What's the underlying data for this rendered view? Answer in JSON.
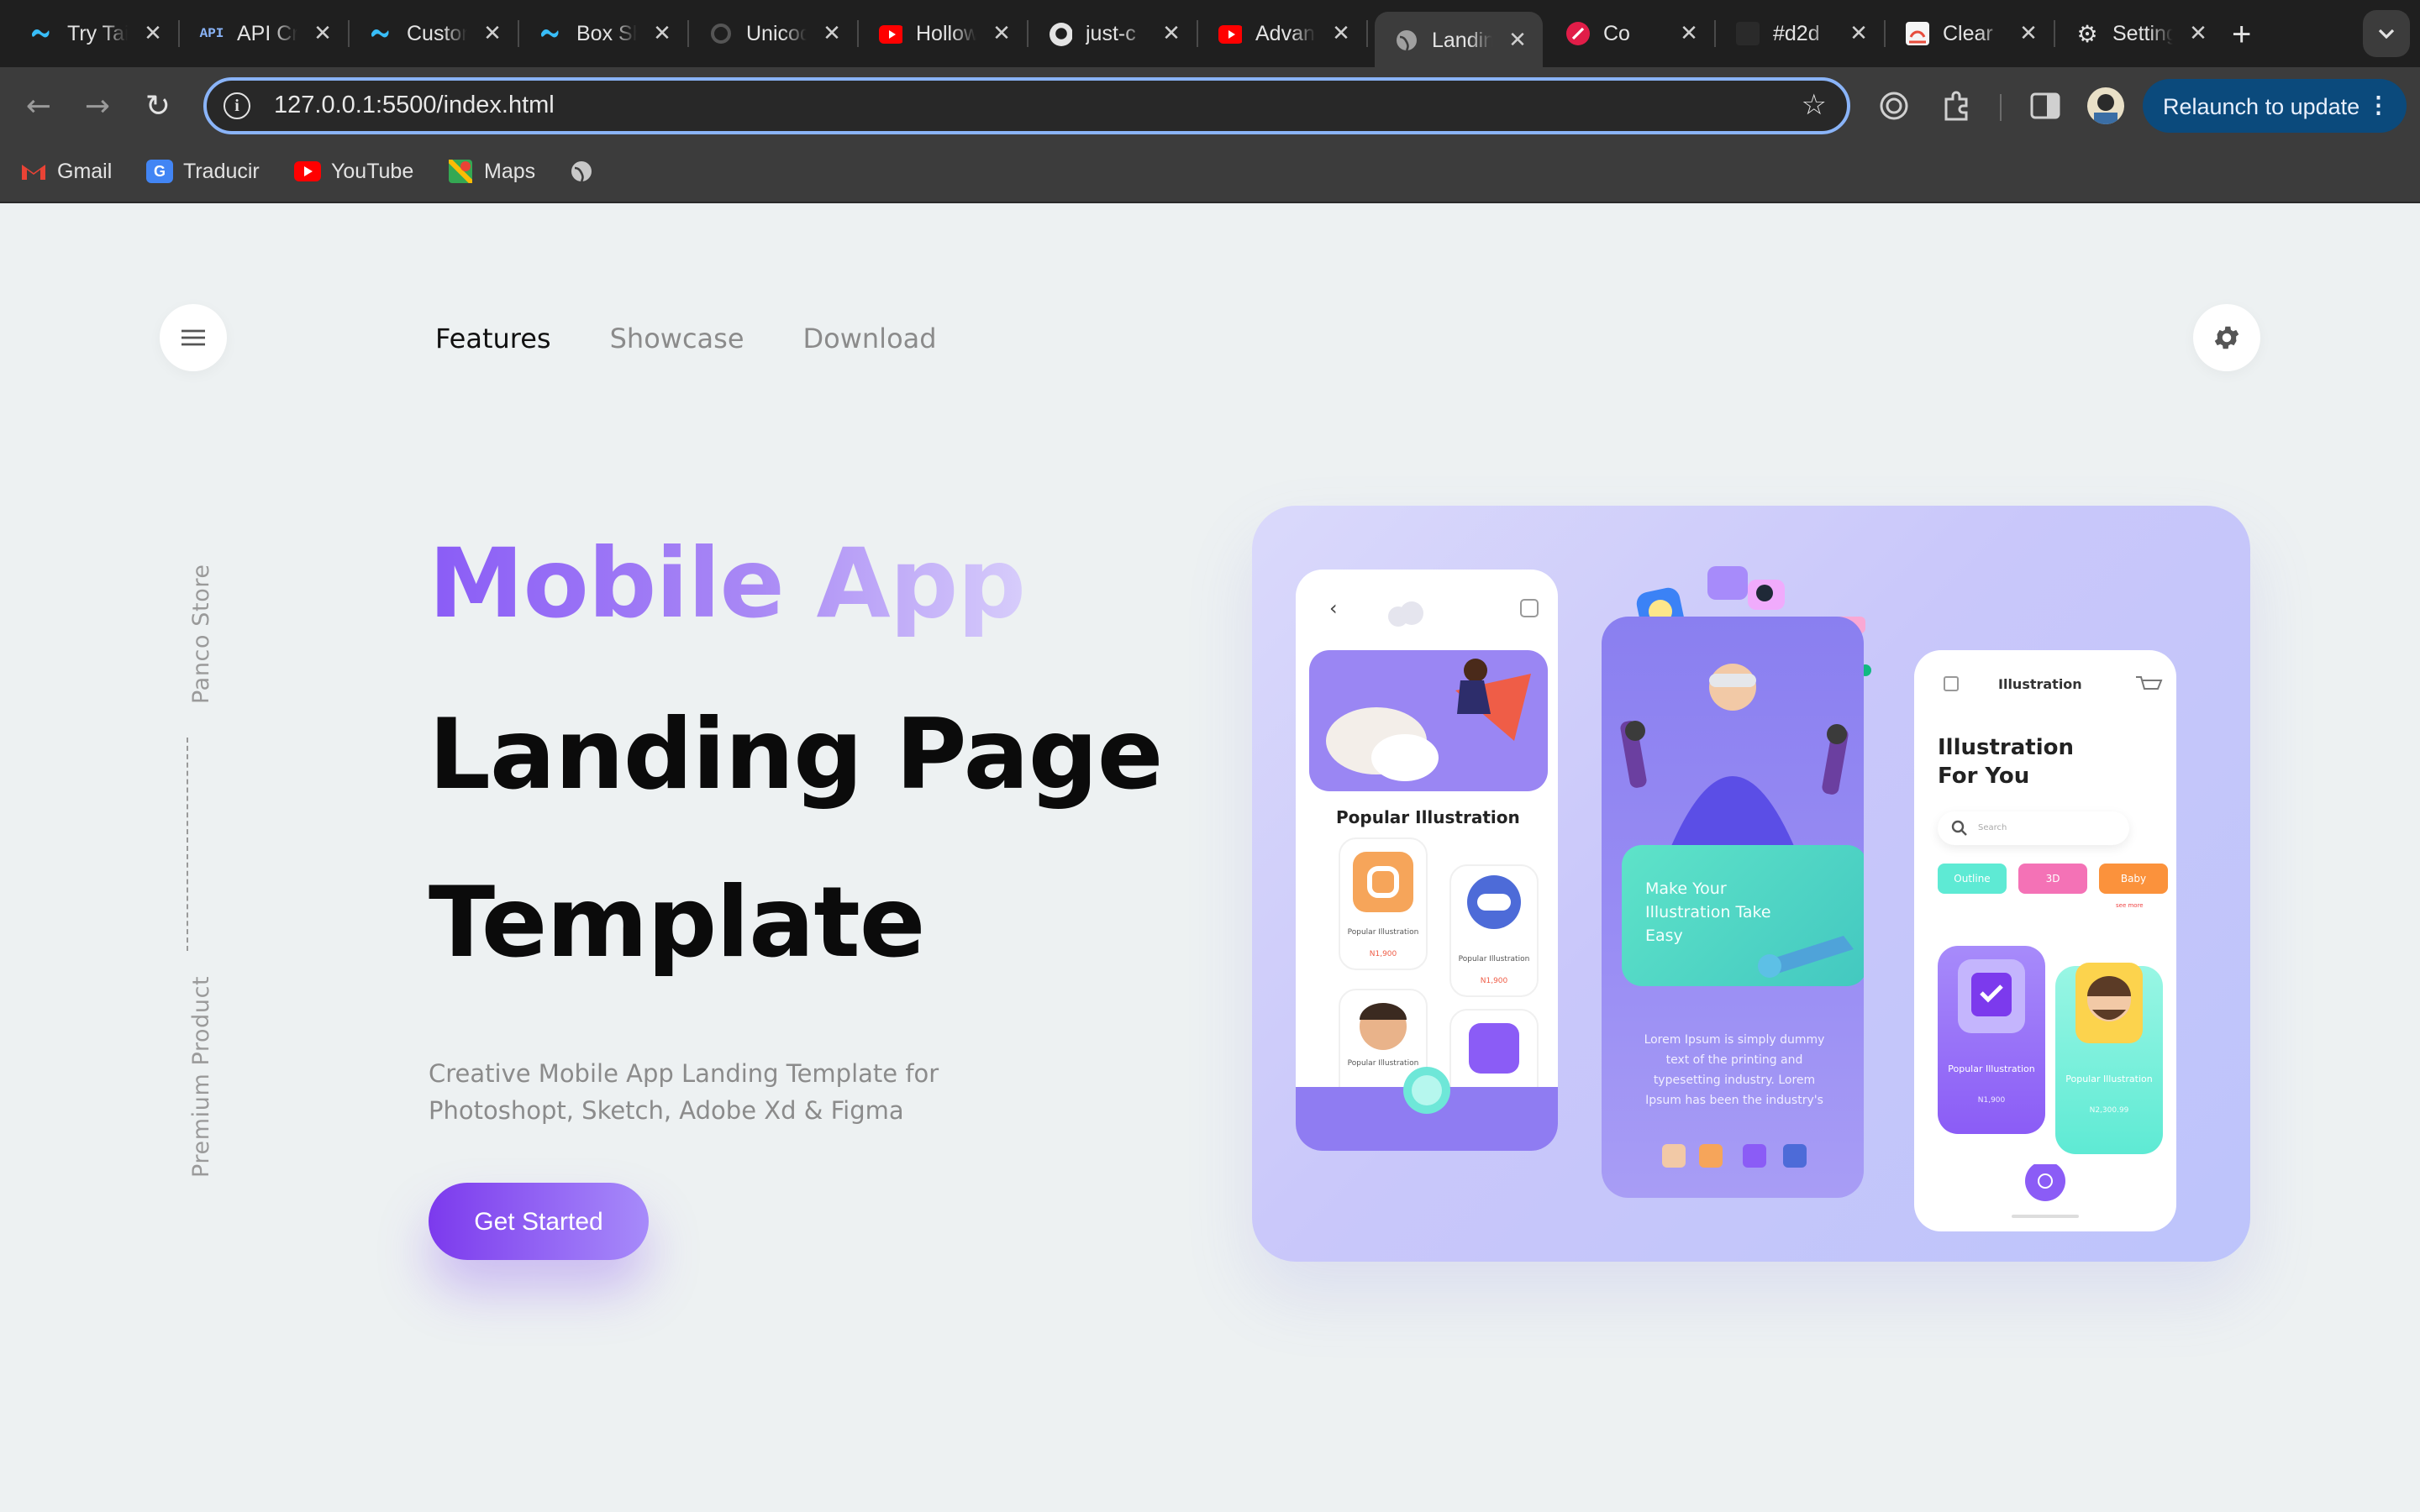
{
  "browser": {
    "tabs": [
      {
        "label": "Try Tailwind",
        "icon": "tailwind-icon"
      },
      {
        "label": "API Credentials",
        "icon": "api-icon"
      },
      {
        "label": "Customize",
        "icon": "tailwind-icon"
      },
      {
        "label": "Box Shadow",
        "icon": "tailwind-icon"
      },
      {
        "label": "Unicode",
        "icon": "spinner-icon"
      },
      {
        "label": "Hollow",
        "icon": "youtube-icon"
      },
      {
        "label": "just-c",
        "icon": "github-icon"
      },
      {
        "label": "Advanced",
        "icon": "youtube-icon"
      },
      {
        "label": "Landing",
        "icon": "globe-icon",
        "active": true
      },
      {
        "label": "Co",
        "icon": "thumbs-up-icon"
      },
      {
        "label": "#d2d",
        "icon": "color-icon"
      },
      {
        "label": "Clear",
        "icon": "clear-icon"
      },
      {
        "label": "Settings",
        "icon": "gear-icon"
      }
    ],
    "url": "127.0.0.1:5500/index.html",
    "relaunch_label": "Relaunch to update",
    "bookmarks": [
      {
        "label": "Gmail",
        "icon": "gmail-icon",
        "color": "#ea4335"
      },
      {
        "label": "Traducir",
        "icon": "translate-icon",
        "color": "#4285f4"
      },
      {
        "label": "YouTube",
        "icon": "youtube-icon",
        "color": "#ff0000"
      },
      {
        "label": "Maps",
        "icon": "maps-icon",
        "color": "#34a853"
      }
    ]
  },
  "site": {
    "nav": {
      "items": [
        "Features",
        "Showcase",
        "Download"
      ],
      "active": "Features"
    },
    "side": {
      "top_text": "Panco Store",
      "bottom_text": "Premium  Product"
    },
    "hero": {
      "line1": "Mobile App",
      "line2": "Landing Page",
      "line3": "Template",
      "description": "Creative Mobile App Landing Template for Photoshopt, Sketch, Adobe Xd & Figma",
      "cta_label": "Get Started"
    },
    "mockup": {
      "phone1": {
        "section_title": "Popular Illustration",
        "cards": [
          {
            "label": "Popular Illustration",
            "price": "N1,900"
          },
          {
            "label": "Popular Illustration",
            "price": "N1,900"
          },
          {
            "label": "Popular Illustration",
            "price": ""
          },
          {
            "label": "",
            "price": ""
          }
        ]
      },
      "phone2": {
        "card_title": "Make Your Illustration Take Easy",
        "body": "Lorem Ipsum is simply dummy text of the printing and typesetting industry. Lorem Ipsum has been the industry's"
      },
      "phone3": {
        "header": "Illustration",
        "title": "Illustration For You",
        "search_placeholder": "Search",
        "chips": [
          "Outline",
          "3D",
          "Baby"
        ],
        "see_more": "see more",
        "cards": [
          {
            "label": "Popular Illustration",
            "price": "N1,900"
          },
          {
            "label": "Popular Illustration",
            "price": "N2,300.99"
          }
        ]
      }
    },
    "colors": {
      "accent": "#7c3aed",
      "accent_light": "#a78bfa",
      "page_bg": "#edf1f2"
    }
  }
}
